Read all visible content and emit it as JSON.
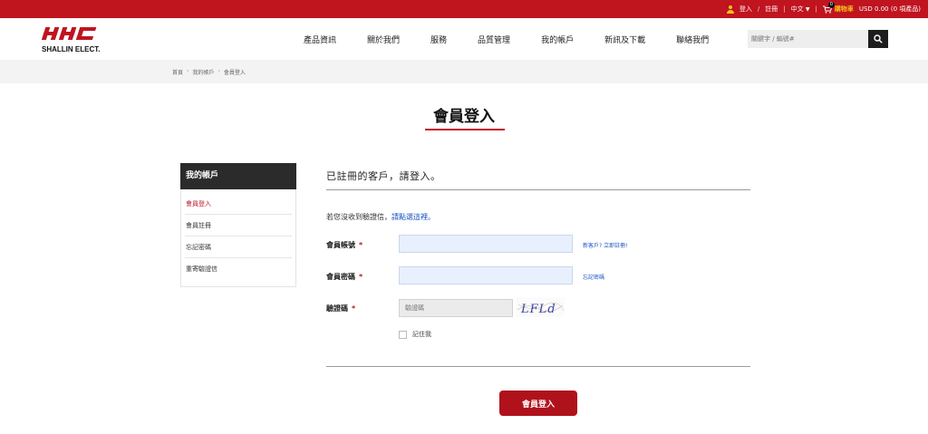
{
  "topbar": {
    "login": "登入",
    "sep_slash": "/",
    "register": "註冊",
    "sep_pipe": "|",
    "language": "中文",
    "cart_count": "0",
    "cart_label": "購物車",
    "cart_summary": "USD 0.00 (0 項產品)"
  },
  "header": {
    "logo_text": "SHALLIN ELECT.",
    "logo_color": "#c0141f",
    "nav": [
      "產品資訊",
      "關於我們",
      "服務",
      "品質管理",
      "我的帳戶",
      "新訊及下載",
      "聯絡我們"
    ],
    "search_placeholder": "關鍵字 / 編號#"
  },
  "breadcrumb": [
    "首頁",
    "我的帳戶",
    "會員登入"
  ],
  "breadcrumb_sep": "›",
  "page_title": "會員登入",
  "sidebar": {
    "title": "我的帳戶",
    "items": [
      "會員登入",
      "會員註冊",
      "忘記密碼",
      "重寄驗證信"
    ]
  },
  "form": {
    "heading": "已註冊的客戶，請登入。",
    "hint_text": "若您沒收到驗證信，",
    "hint_link": "請點選這裡。",
    "account_label": "會員帳號",
    "password_label": "會員密碼",
    "captcha_label": "驗證碼",
    "required_mark": "*",
    "captcha_placeholder": "驗證碼",
    "register_link": "新客戶? 立即註冊!",
    "forgot_link": "忘記密碼",
    "captcha_text": "LFLd",
    "remember_label": "記住我",
    "submit_label": "會員登入"
  },
  "colors": {
    "brand_red": "#c0141f",
    "link_blue": "#1a52c4",
    "cart_yellow": "#f7c21b"
  }
}
